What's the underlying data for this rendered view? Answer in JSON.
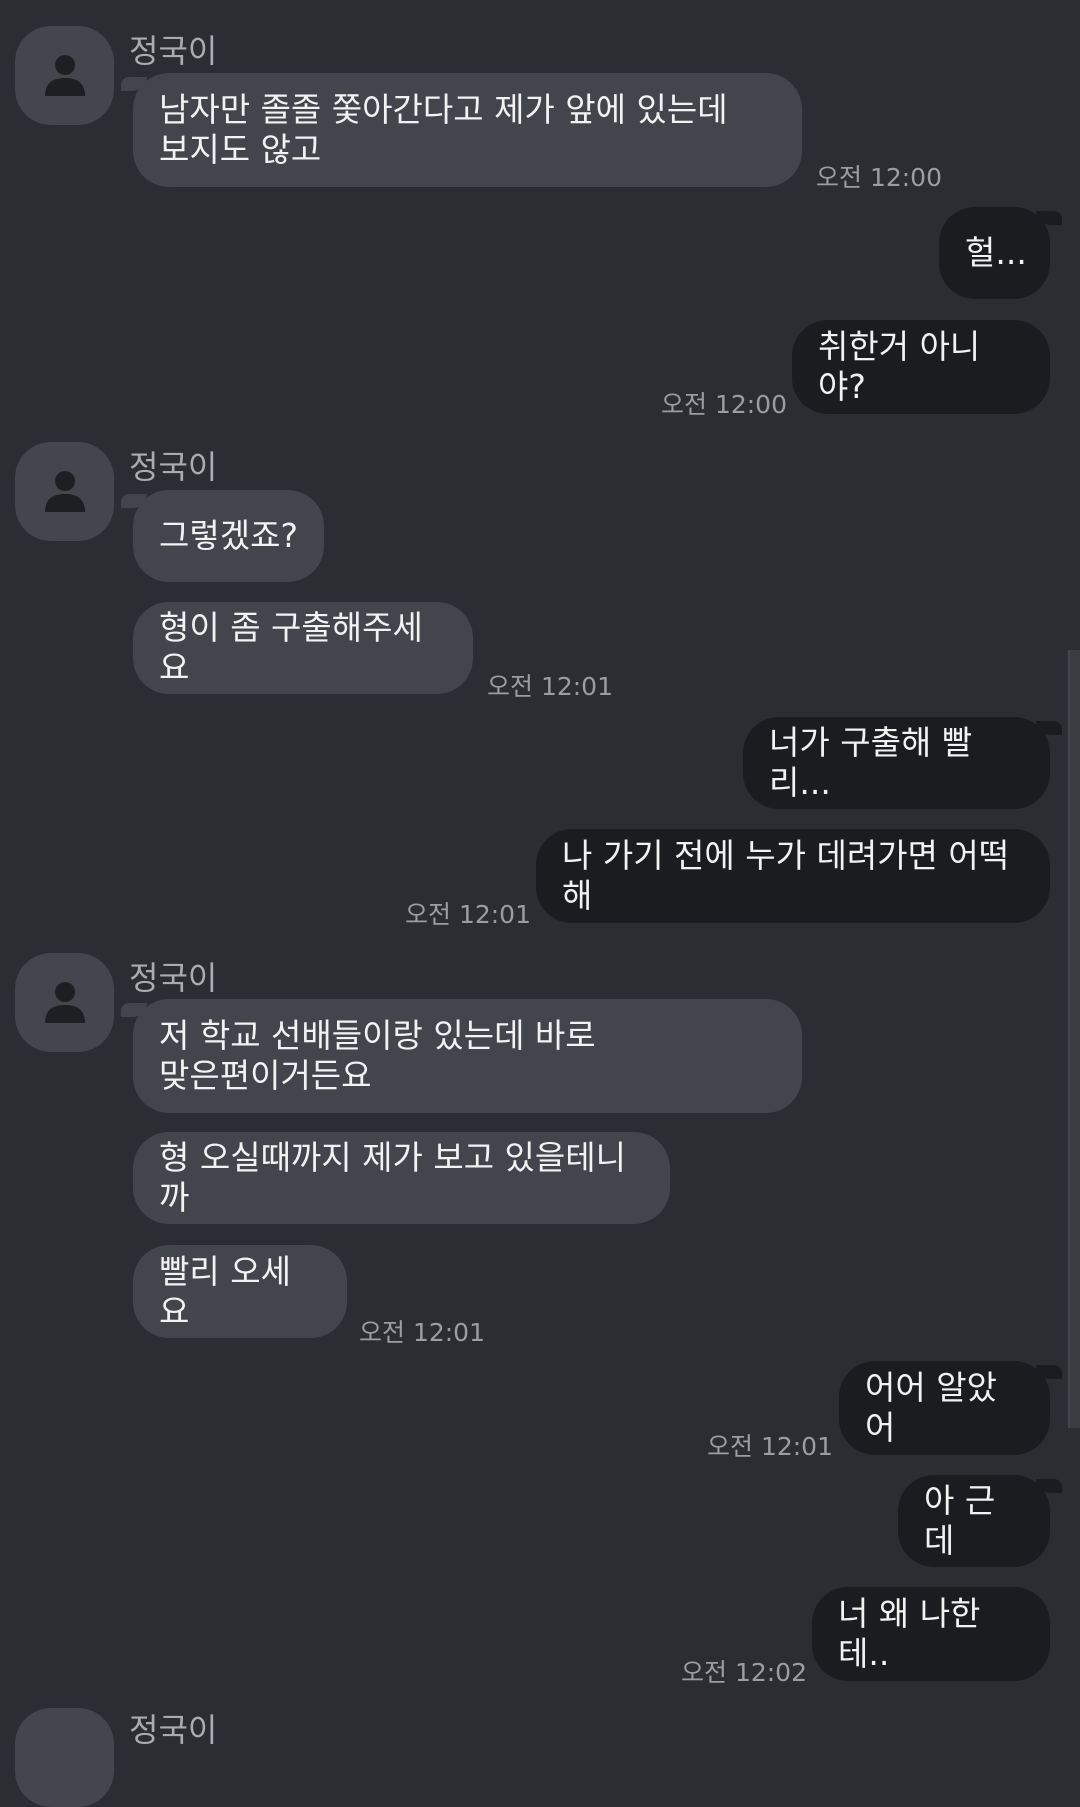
{
  "contact": {
    "name": "정국이"
  },
  "messages": [
    {
      "text": "남자만 졸졸 쫓아간다고 제가 앞에 있는데\n보지도 않고",
      "time": "오전 12:00"
    },
    {
      "text": "헐..."
    },
    {
      "text": "취한거 아니야?",
      "time": "오전 12:00"
    },
    {
      "text": "그렇겠죠?"
    },
    {
      "text": "형이 좀 구출해주세요",
      "time": "오전 12:01"
    },
    {
      "text": "너가 구출해 빨리..."
    },
    {
      "text": "나 가기 전에 누가 데려가면 어떡해",
      "time": "오전 12:01"
    },
    {
      "text": "저 학교 선배들이랑 있는데 바로\n맞은편이거든요"
    },
    {
      "text": "형 오실때까지 제가 보고 있을테니까"
    },
    {
      "text": "빨리 오세요",
      "time": "오전 12:01"
    },
    {
      "text": "어어 알았어",
      "time": "오전 12:01"
    },
    {
      "text": "아 근데"
    },
    {
      "text": "너 왜 나한테..",
      "time": "오전 12:02"
    }
  ]
}
